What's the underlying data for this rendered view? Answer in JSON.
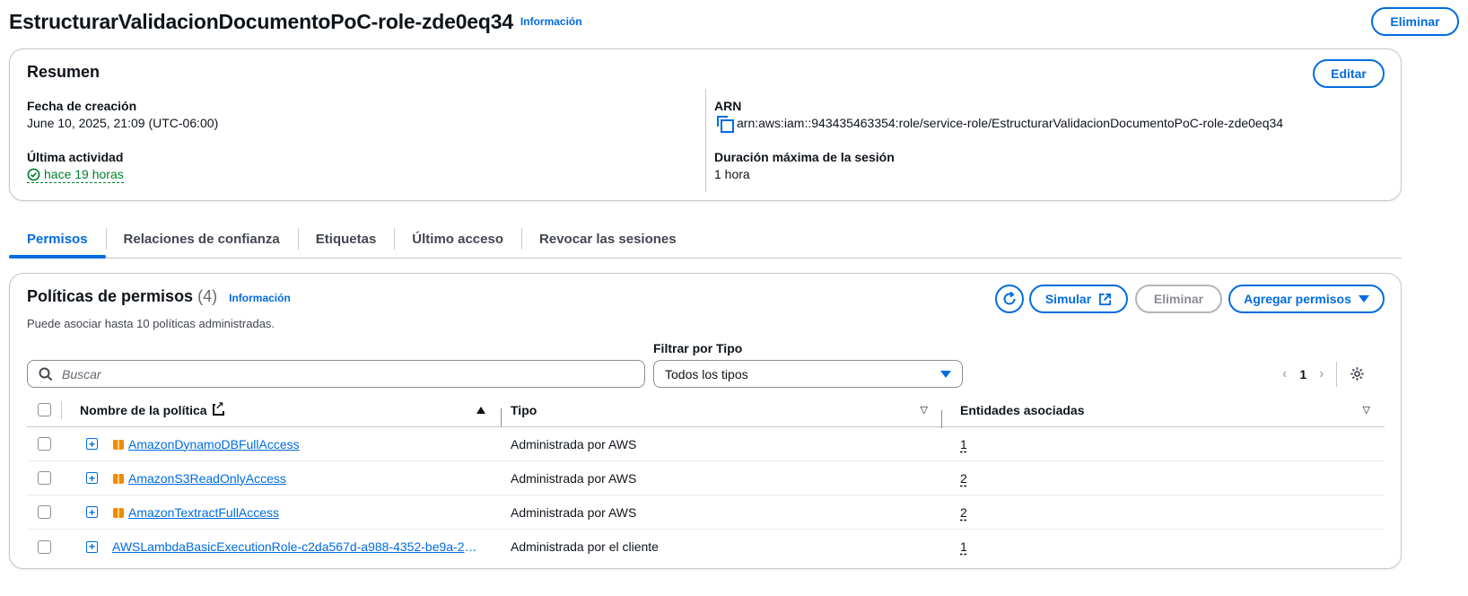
{
  "header": {
    "title": "EstructurarValidacionDocumentoPoC-role-zde0eq34",
    "info_link": "Información",
    "delete_button": "Eliminar"
  },
  "summary": {
    "title": "Resumen",
    "edit_button": "Editar",
    "creation_label": "Fecha de creación",
    "creation_value": "June 10, 2025, 21:09 (UTC-06:00)",
    "last_activity_label": "Última actividad",
    "last_activity_value": "hace 19 horas",
    "arn_label": "ARN",
    "arn_value": "arn:aws:iam::943435463354:role/service-role/EstructurarValidacionDocumentoPoC-role-zde0eq34",
    "max_session_label": "Duración máxima de la sesión",
    "max_session_value": "1 hora"
  },
  "tabs": [
    {
      "label": "Permisos",
      "active": true
    },
    {
      "label": "Relaciones de confianza",
      "active": false
    },
    {
      "label": "Etiquetas",
      "active": false
    },
    {
      "label": "Último acceso",
      "active": false
    },
    {
      "label": "Revocar las sesiones",
      "active": false
    }
  ],
  "policies": {
    "title": "Políticas de permisos",
    "count": "(4)",
    "info_link": "Información",
    "description": "Puede asociar hasta 10 políticas administradas.",
    "simulate_button": "Simular",
    "delete_button": "Eliminar",
    "add_button": "Agregar permisos",
    "filter_label": "Filtrar por Tipo",
    "search_placeholder": "Buscar",
    "filter_value": "Todos los tipos",
    "page_number": "1",
    "columns": {
      "name": "Nombre de la política",
      "type": "Tipo",
      "entities": "Entidades asociadas"
    },
    "rows": [
      {
        "name": "AmazonDynamoDBFullAccess",
        "type": "Administrada por AWS",
        "entities": "1",
        "aws_icon": true
      },
      {
        "name": "AmazonS3ReadOnlyAccess",
        "type": "Administrada por AWS",
        "entities": "2",
        "aws_icon": true
      },
      {
        "name": "AmazonTextractFullAccess",
        "type": "Administrada por AWS",
        "entities": "2",
        "aws_icon": true
      },
      {
        "name": "AWSLambdaBasicExecutionRole-c2da567d-a988-4352-be9a-240...",
        "type": "Administrada por el cliente",
        "entities": "1",
        "aws_icon": false
      }
    ]
  },
  "colors": {
    "accent": "#006ce0",
    "success": "#00802f",
    "aws_orange": "#f08c00",
    "border": "#c6c6cd"
  }
}
